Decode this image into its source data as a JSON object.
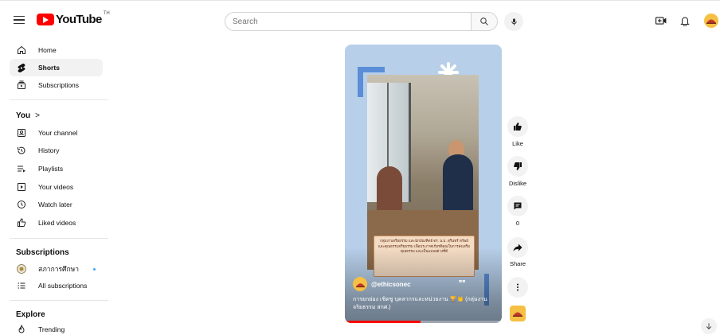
{
  "header": {
    "logo_text": "YouTube",
    "logo_tm": "TH",
    "search_placeholder": "Search"
  },
  "sidebar": {
    "main": [
      {
        "label": "Home",
        "icon": "home-icon"
      },
      {
        "label": "Shorts",
        "icon": "shorts-icon",
        "active": true
      },
      {
        "label": "Subscriptions",
        "icon": "subscriptions-icon"
      }
    ],
    "you_title": "You",
    "you_chevron": ">",
    "you": [
      {
        "label": "Your channel",
        "icon": "your-channel-icon"
      },
      {
        "label": "History",
        "icon": "history-icon"
      },
      {
        "label": "Playlists",
        "icon": "playlists-icon"
      },
      {
        "label": "Your videos",
        "icon": "your-videos-icon"
      },
      {
        "label": "Watch later",
        "icon": "watch-later-icon"
      },
      {
        "label": "Liked videos",
        "icon": "liked-videos-icon"
      }
    ],
    "subscriptions_title": "Subscriptions",
    "subscriptions": [
      {
        "label": "สภาการศึกษา",
        "icon": "channel-avatar-icon",
        "new": true
      },
      {
        "label": "All subscriptions",
        "icon": "all-subscriptions-icon"
      }
    ],
    "explore_title": "Explore",
    "explore": [
      {
        "label": "Trending",
        "icon": "trending-icon"
      }
    ]
  },
  "short": {
    "caption_text": "กลุ่มงานจริยธรรม และนักบัณฑิตย์ ดร. น.ม. สุรินทร์ ทรัพย์ และคุณธรรมจริยธรรม เพื่อประกาศเกียรติคุณในการส่งเสริมคุณธรรม และเป็นแบบอย่างที่ดี",
    "channel": "@ethicsonec",
    "quote_mark": "❞❞",
    "title": "การยกย่อง เชิดชู บุคลากรและหน่วยงาน 🏆👏 (กลุ่มงานจริยธรรม สกศ.)",
    "progress": 0.48
  },
  "actions": {
    "like_label": "Like",
    "dislike_label": "Dislike",
    "comments_count": "0",
    "share_label": "Share"
  },
  "colors": {
    "brand": "#ff0000",
    "short_bg": "#b7cfe9",
    "accent_blue": "#5b8ed6"
  }
}
